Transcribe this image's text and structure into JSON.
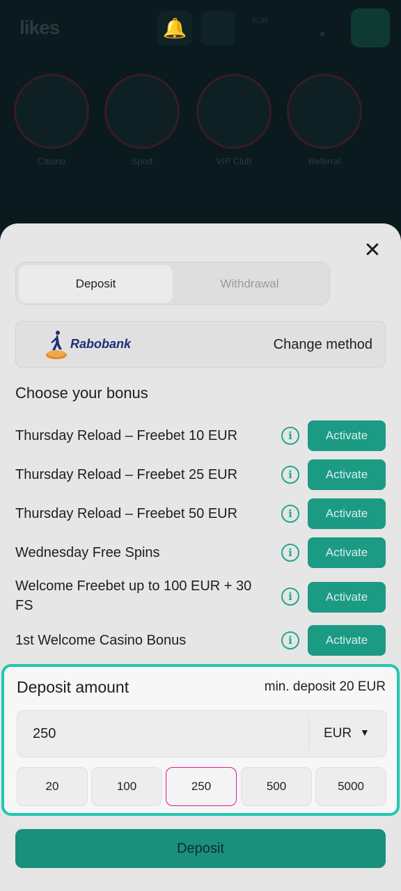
{
  "background": {
    "logo_text": "likes",
    "currency_small": "EUR",
    "categories": [
      "Casino",
      "Sport",
      "VIP Club",
      "Referral"
    ]
  },
  "modal": {
    "tabs": [
      {
        "label": "Deposit",
        "active": true
      },
      {
        "label": "Withdrawal",
        "active": false
      }
    ],
    "method": {
      "bank_name": "Rabobank",
      "change_label": "Change method"
    },
    "bonus_heading": "Choose your bonus",
    "bonuses": [
      {
        "name": "Thursday Reload – Freebet 10 EUR",
        "action": "Activate"
      },
      {
        "name": "Thursday Reload – Freebet 25 EUR",
        "action": "Activate"
      },
      {
        "name": "Thursday Reload – Freebet 50 EUR",
        "action": "Activate"
      },
      {
        "name": "Wednesday Free Spins",
        "action": "Activate"
      },
      {
        "name": "Welcome Freebet up to 100 EUR + 30 FS",
        "action": "Activate"
      },
      {
        "name": "1st Welcome Casino Bonus",
        "action": "Activate"
      }
    ],
    "amount": {
      "title": "Deposit amount",
      "min_deposit": "min. deposit 20 EUR",
      "value": "250",
      "currency": "EUR",
      "quick_amounts": [
        "20",
        "100",
        "250",
        "500",
        "5000"
      ],
      "selected_quick": "250"
    },
    "deposit_button": "Deposit"
  },
  "colors": {
    "accent": "#1b9a84",
    "highlight_border": "#1fc7b0",
    "selected_border": "#e1198b",
    "bank_blue": "#1b2f7a"
  },
  "icons": {
    "close": "close-icon",
    "info": "info-icon",
    "dropdown": "chevron-down-icon",
    "bell": "bell-icon"
  }
}
